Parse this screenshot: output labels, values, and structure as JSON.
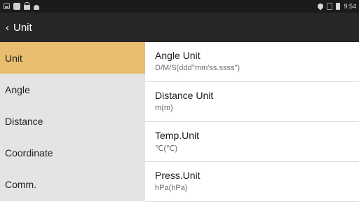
{
  "status_bar": {
    "left_icons": [
      "image-icon",
      "square-icon",
      "lock-icon",
      "android-icon"
    ],
    "right_icons": [
      "location-icon",
      "sim-icon",
      "battery-icon"
    ],
    "time": "9:54"
  },
  "app_bar": {
    "back_icon": "‹",
    "title": "Unit"
  },
  "sidebar": {
    "items": [
      {
        "label": "Unit",
        "active": true
      },
      {
        "label": "Angle",
        "active": false
      },
      {
        "label": "Distance",
        "active": false
      },
      {
        "label": "Coordinate",
        "active": false
      },
      {
        "label": "Comm.",
        "active": false
      }
    ]
  },
  "settings": [
    {
      "title": "Angle Unit",
      "value": "D/M/S(ddd°mm'ss.ssss\")"
    },
    {
      "title": "Distance Unit",
      "value": "m(m)"
    },
    {
      "title": "Temp.Unit",
      "value": "℃(℃)"
    },
    {
      "title": "Press.Unit",
      "value": "hPa(hPa)"
    }
  ],
  "colors": {
    "active_item": "#e9bd70",
    "app_bar": "#262626",
    "status_bar": "#1b1b1b",
    "sidebar": "#e4e4e4"
  }
}
